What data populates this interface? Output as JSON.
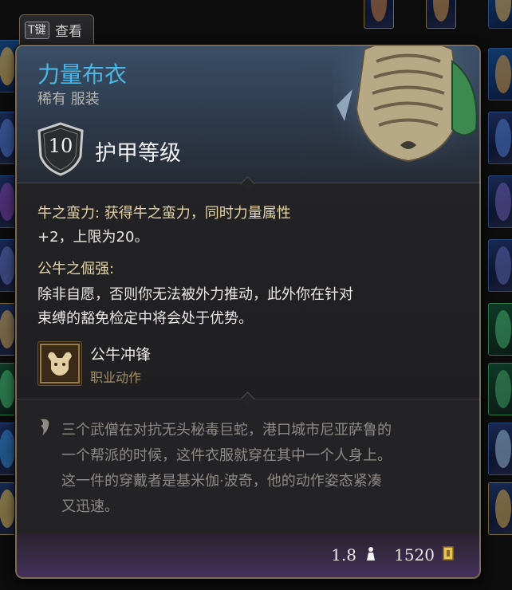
{
  "key_hint": {
    "key": "T键",
    "label": "查看"
  },
  "item": {
    "name": "力量布衣",
    "rarity_type": "稀有 服装",
    "armor_class": "10",
    "armor_label": "护甲等级"
  },
  "effects": [
    {
      "line1": "牛之蛮力: 获得牛之蛮力，同时力量属性",
      "line2": "+2，上限为20。"
    },
    {
      "title": "公牛之倔强:",
      "line1": "除非自愿，否则你无法被外力推动，此外你在针对",
      "line2": "束缚的豁免检定中将会处于优势。"
    }
  ],
  "action": {
    "name": "公牛冲锋",
    "type": "职业动作",
    "icon": "bull-icon"
  },
  "lore": [
    "三个武僧在对抗无头秘毒巨蛇，港口城市尼亚萨鲁的",
    "一个帮派的时候，这件衣服就穿在其中一个人身上。",
    "这一件的穿戴者是基米伽·波奇，他的动作姿态紧凑",
    "又迅速。"
  ],
  "footer": {
    "weight": "1.8",
    "weight_icon": "weight-icon",
    "value": "1520",
    "value_icon": "gold-coin-icon"
  },
  "colors": {
    "name": "#4ab8e6",
    "gold_text": "#e6d3a3",
    "border": "#7b6a55",
    "footer": "#43305a"
  }
}
